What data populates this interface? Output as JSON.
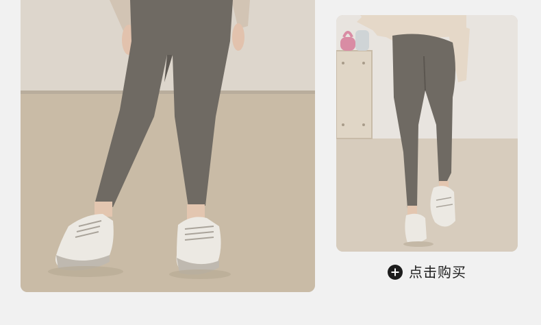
{
  "product": {
    "main_image": {
      "alt_icon": "leggings-front-photo"
    },
    "side_image": {
      "alt_icon": "leggings-back-photo"
    }
  },
  "actions": {
    "buy_label": "点击购买",
    "buy_icon": "plus-circle-icon"
  },
  "colors": {
    "page_background": "#f1f1f1",
    "leggings": "#6f6a63",
    "button_text": "#1d1d1d"
  }
}
